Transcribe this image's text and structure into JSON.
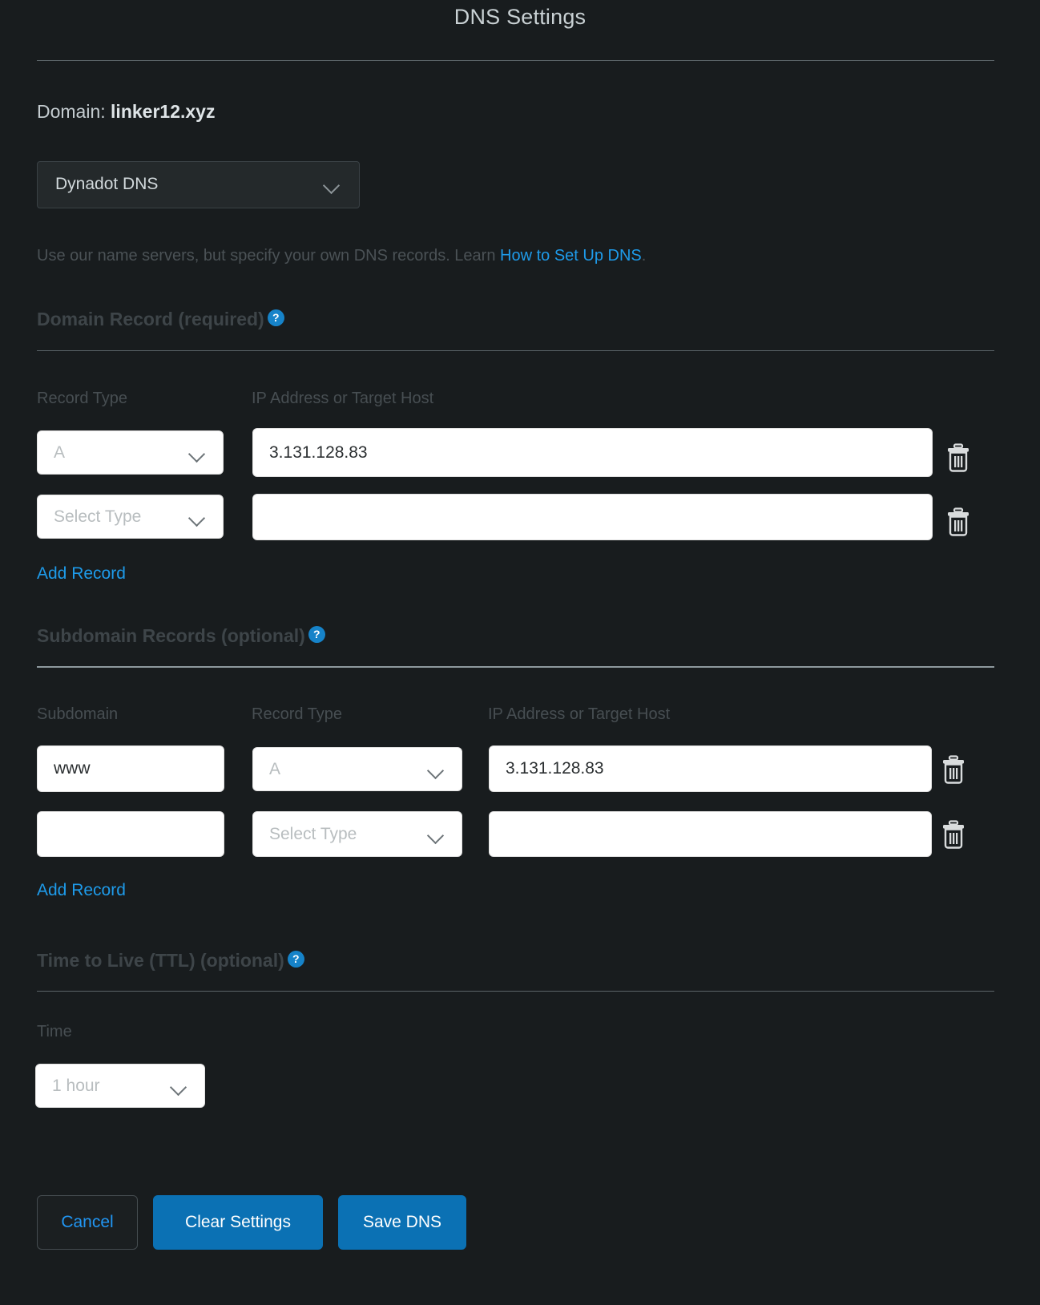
{
  "header": {
    "title": "DNS Settings"
  },
  "domain": {
    "label": "Domain:",
    "name": "linker12.xyz"
  },
  "provider": {
    "selected": "Dynadot DNS",
    "chevron_icon": "chevron-down-icon"
  },
  "helper": {
    "text": "Use our name servers, but specify your own DNS records. Learn ",
    "link": "How to Set Up DNS",
    "suffix": "."
  },
  "domain_record": {
    "heading": "Domain Record (required)",
    "help_icon": "help-circle-icon",
    "columns": {
      "record_type": "Record Type",
      "target": "IP Address or Target Host"
    },
    "rows": [
      {
        "type_value": "A",
        "type_placeholder": "A",
        "target_value": "3.131.128.83",
        "delete_icon": "trash-icon"
      },
      {
        "type_value": "",
        "type_placeholder": "Select Type",
        "target_value": "",
        "delete_icon": "trash-icon"
      }
    ],
    "add_record": "Add Record"
  },
  "subdomain_records": {
    "heading": "Subdomain Records (optional)",
    "help_icon": "help-circle-icon",
    "columns": {
      "subdomain": "Subdomain",
      "record_type": "Record Type",
      "target": "IP Address or Target Host"
    },
    "rows": [
      {
        "subdomain_value": "www",
        "type_value": "A",
        "type_placeholder": "A",
        "target_value": "3.131.128.83",
        "delete_icon": "trash-icon"
      },
      {
        "subdomain_value": "",
        "type_value": "",
        "type_placeholder": "Select Type",
        "target_value": "",
        "delete_icon": "trash-icon"
      }
    ],
    "add_record": "Add Record"
  },
  "ttl": {
    "heading": "Time to Live (TTL) (optional)",
    "help_icon": "help-circle-icon",
    "time_label": "Time",
    "time_value": "1 hour",
    "chevron_icon": "chevron-down-icon"
  },
  "footer": {
    "cancel": "Cancel",
    "clear": "Clear Settings",
    "save": "Save DNS"
  },
  "colors": {
    "background": "#181c1e",
    "accent_blue": "#1e9bea",
    "button_blue": "#0b71b4",
    "help_badge": "#1683c9",
    "divider": "#5b6468",
    "muted_text": "#474e52"
  }
}
